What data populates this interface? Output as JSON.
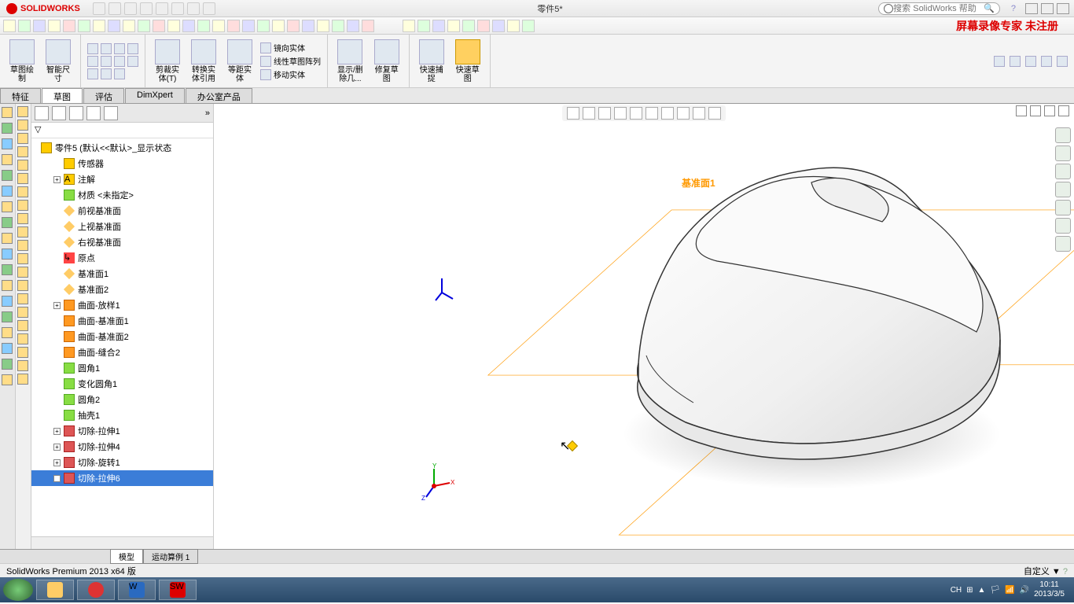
{
  "logo_text": "SOLIDWORKS",
  "doc_title": "零件5*",
  "search_placeholder": "搜索 SolidWorks 帮助",
  "watermark": "屏幕录像专家 未注册",
  "ribbon": {
    "sketch": "草图绘\n制",
    "smart_dim": "智能尺\n寸",
    "trim": "剪裁实\n体(T)",
    "convert": "转换实\n体引用",
    "equal_dist": "等距实\n体",
    "mirror": "镜向实体",
    "linear_pattern": "线性草图阵列",
    "move": "移动实体",
    "show_hide": "显示/删\n除几...",
    "repair": "修复草\n图",
    "quick_snap": "快速捕\n捉",
    "quick_sketch": "快速草\n图"
  },
  "tabs": {
    "features": "特征",
    "sketch": "草图",
    "evaluate": "评估",
    "dimxpert": "DimXpert",
    "office": "办公室产品"
  },
  "tree": {
    "root": "零件5  (默认<<默认>_显示状态",
    "sensors": "传感器",
    "annotations": "注解",
    "material": "材质 <未指定>",
    "front_plane": "前视基准面",
    "top_plane": "上视基准面",
    "right_plane": "右视基准面",
    "origin": "原点",
    "plane1": "基准面1",
    "plane2": "基准面2",
    "loft": "曲面-放样1",
    "surf1": "曲面-基准面1",
    "surf2": "曲面-基准面2",
    "knit": "曲面-缝合2",
    "fillet1": "圆角1",
    "varfillet": "变化圆角1",
    "fillet2": "圆角2",
    "shell": "抽壳1",
    "cut1": "切除-拉伸1",
    "cut4": "切除-拉伸4",
    "revcut": "切除-旋转1",
    "cut6": "切除-拉伸6"
  },
  "plane_labels": {
    "p1": "基准面1",
    "p2": "基准面2"
  },
  "bottom_tabs": {
    "model": "模型",
    "motion": "运动算例 1"
  },
  "status_text": "SolidWorks Premium 2013 x64 版",
  "status_r": "自定义",
  "taskbar": {
    "ime": "CH",
    "time": "10:11",
    "date": "2013/3/5"
  }
}
